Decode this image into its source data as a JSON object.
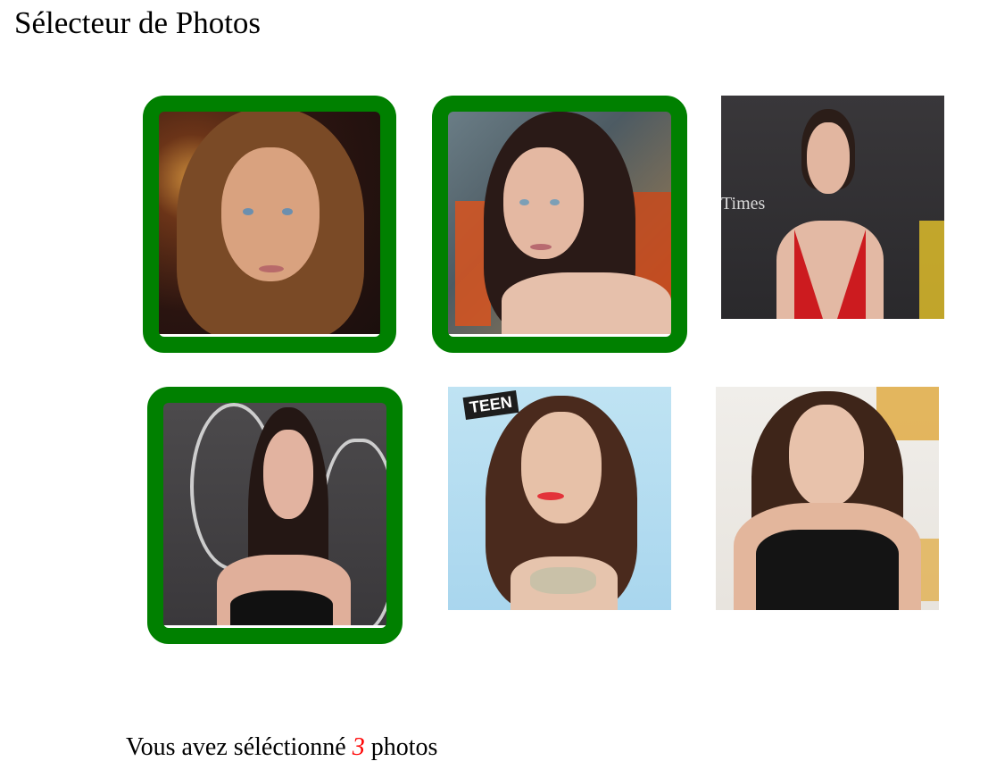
{
  "page": {
    "title": "Sélecteur de Photos"
  },
  "photos": [
    {
      "id": "photo-1",
      "selected": true,
      "alt": ""
    },
    {
      "id": "photo-2",
      "selected": true,
      "alt": ""
    },
    {
      "id": "photo-3",
      "selected": false,
      "alt": "Times"
    },
    {
      "id": "photo-4",
      "selected": true,
      "alt": ""
    },
    {
      "id": "photo-5",
      "selected": false,
      "alt": "TEEN"
    },
    {
      "id": "photo-6",
      "selected": false,
      "alt": ""
    }
  ],
  "status": {
    "prefix": "Vous avez séléctionné",
    "count": "3",
    "suffix": "photos"
  },
  "colors": {
    "selected_border": "#008000",
    "count_color": "#ff0000"
  }
}
